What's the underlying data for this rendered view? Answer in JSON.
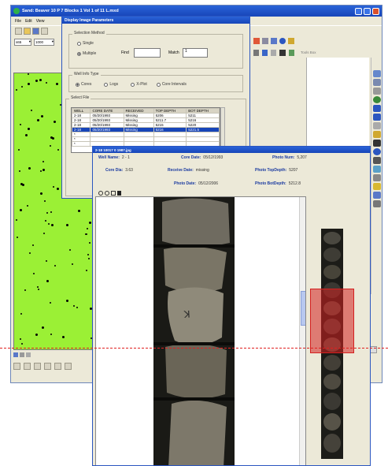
{
  "main_window": {
    "title": "Sand: Beaver 10 P 7 Blocks 1 Vol 1 of 11 L.mxd",
    "menu": [
      "File",
      "Edit",
      "View"
    ],
    "layer_combo": "s65",
    "scale_combo": "1000",
    "toolbar_right_label": "Tools Box"
  },
  "settings_dialog": {
    "title": "Display Image Parameters",
    "selection_method": {
      "label": "Selection Method",
      "options": [
        "Single",
        "Multiple"
      ],
      "selected": "Multiple",
      "find_label": "Find",
      "find_value": "",
      "match_label": "Match",
      "match_value": "1"
    },
    "well_info_type": {
      "label": "Well Info Type",
      "options": [
        "Cores",
        "Logs",
        "X-Plot",
        "Core Intervals"
      ],
      "selected": "Cores"
    },
    "select_file": {
      "label": "Select File",
      "columns": [
        "WELL",
        "CORE DATE",
        "RECEIVED",
        "TOP DEPTH",
        "BOT DEPTH"
      ],
      "rows": [
        [
          "2-18",
          "05/20/1993",
          "Missing",
          "5206",
          "5211"
        ],
        [
          "2-18",
          "05/20/1993",
          "Missing",
          "5211.7",
          "5216"
        ],
        [
          "2-18",
          "05/20/1993",
          "Missing",
          "5215",
          "5220"
        ],
        [
          "2-18",
          "05/20/1993",
          "Missing",
          "5216",
          "5221.5"
        ],
        [
          "*",
          "",
          "",
          "",
          ""
        ],
        [
          "*",
          "",
          "",
          "",
          ""
        ],
        [
          "*",
          "",
          "",
          "",
          ""
        ]
      ],
      "selected_row": 3
    }
  },
  "photo_window": {
    "title": "2-18 10017 0 1987.jpg",
    "info": {
      "well_name_label": "Well Name:",
      "well_name_value": "2 - 1",
      "core_date_label": "Core Date:",
      "core_date_value": "05/12/1993",
      "photo_num_label": "Photo Num:",
      "photo_num_value": "5,207",
      "core_dia_label": "Core Dia:",
      "core_dia_value": "3.63",
      "receive_date_label": "Receive Date:",
      "receive_date_value": "missing",
      "photo_top_label": "Photo TopDepth:",
      "photo_top_value": "5207",
      "photo_date_label": "Photo Date:",
      "photo_date_value": "05/12/2006",
      "photo_bot_label": "Photo BotDepth:",
      "photo_bot_value": "5212.8"
    }
  },
  "colors": {
    "map_background": "#9bf035",
    "title_bar": "#1f52c8",
    "selection_overlay": "#d42020",
    "guide_line": "#e02020"
  }
}
